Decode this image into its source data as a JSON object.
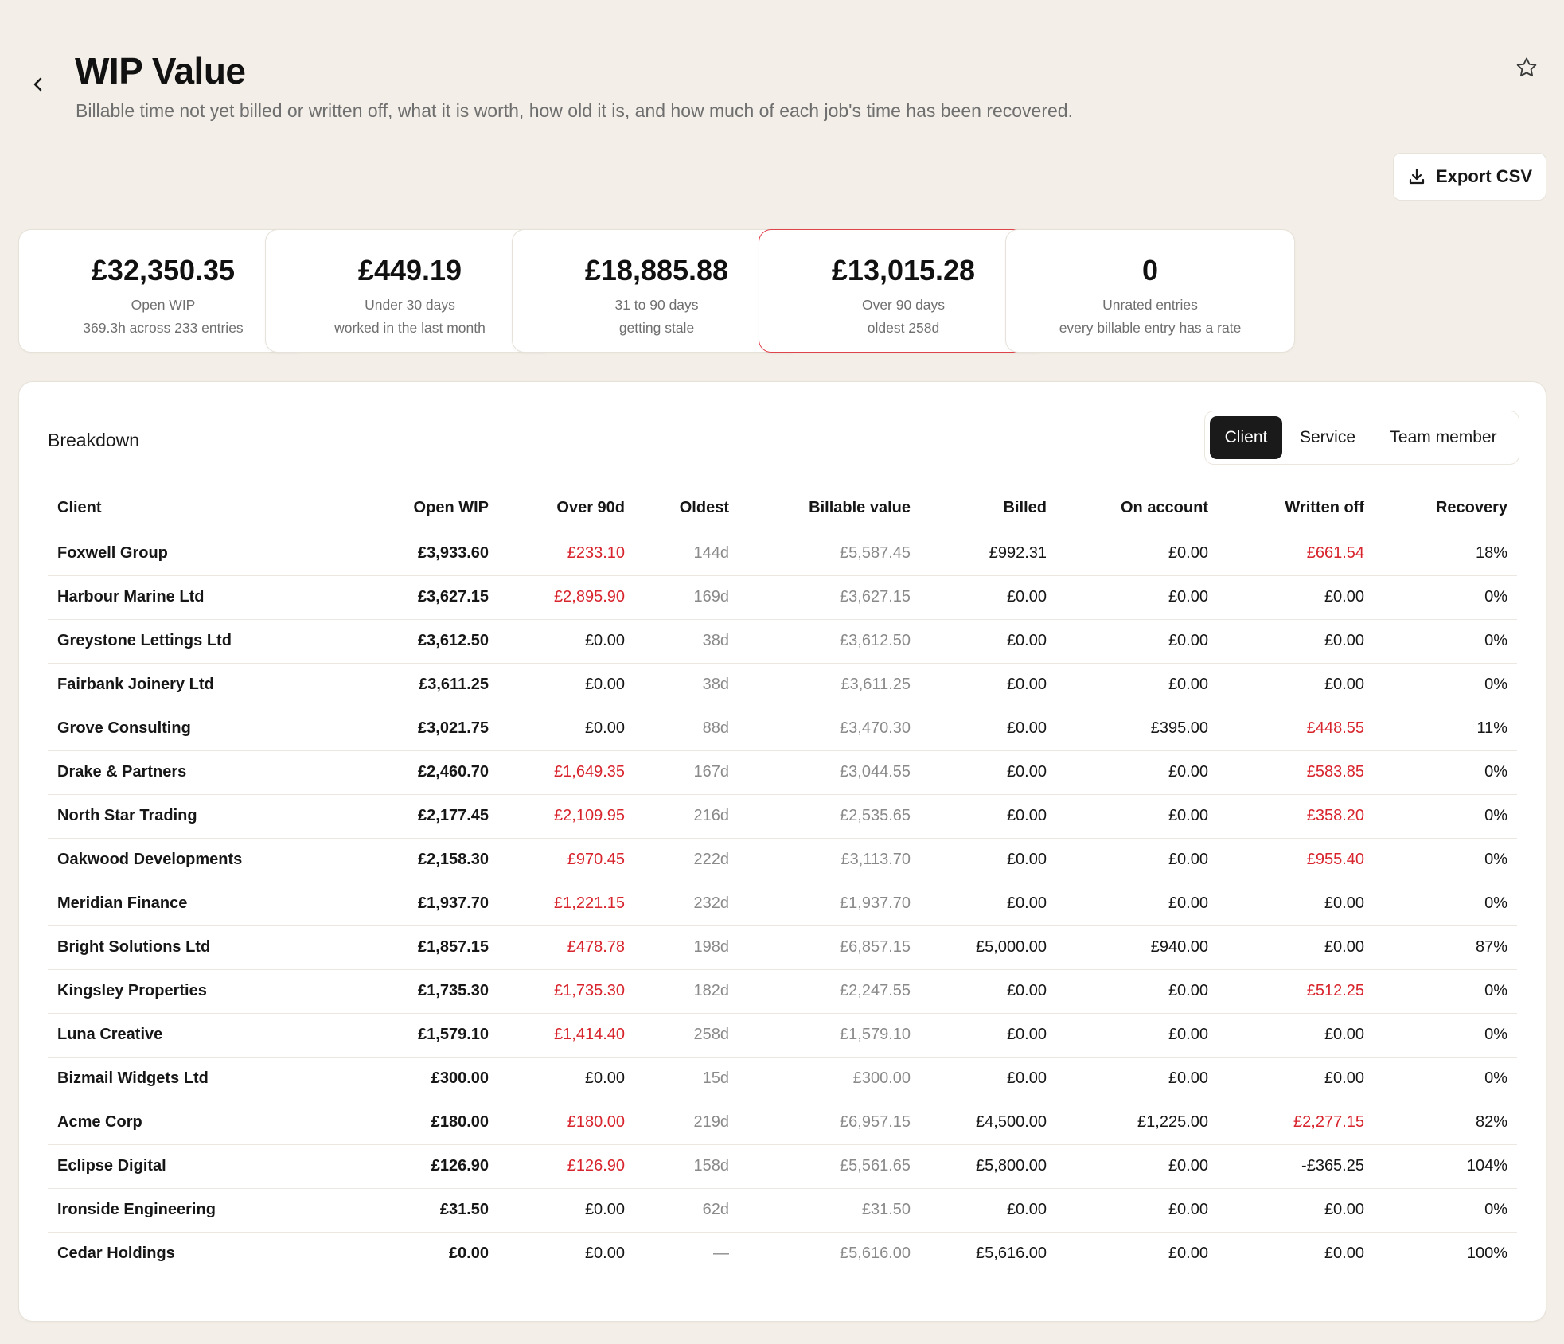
{
  "header": {
    "title": "WIP Value",
    "subtitle": "Billable time not yet billed or written off, what it is worth, how old it is, and how much of each job's time has been recovered.",
    "export_label": "Export CSV"
  },
  "cards": [
    {
      "value": "£32,350.35",
      "label": "Open WIP",
      "sub": "369.3h across 233 entries",
      "alert": false
    },
    {
      "value": "£449.19",
      "label": "Under 30 days",
      "sub": "worked in the last month",
      "alert": false
    },
    {
      "value": "£18,885.88",
      "label": "31 to 90 days",
      "sub": "getting stale",
      "alert": false
    },
    {
      "value": "£13,015.28",
      "label": "Over 90 days",
      "sub": "oldest 258d",
      "alert": true
    },
    {
      "value": "0",
      "label": "Unrated entries",
      "sub": "every billable entry has a rate",
      "alert": false
    }
  ],
  "breakdown": {
    "title": "Breakdown",
    "tabs": [
      "Client",
      "Service",
      "Team member"
    ],
    "active_tab": "Client",
    "columns": [
      "Client",
      "Open WIP",
      "Over 90d",
      "Oldest",
      "Billable value",
      "Billed",
      "On account",
      "Written off",
      "Recovery"
    ],
    "rows": [
      {
        "client": "Foxwell Group",
        "open_wip": "£3,933.60",
        "over_90d": "£233.10",
        "oldest": "144d",
        "billable": "£5,587.45",
        "billed": "£992.31",
        "on_account": "£0.00",
        "written_off": "£661.54",
        "recovery": "18%"
      },
      {
        "client": "Harbour Marine Ltd",
        "open_wip": "£3,627.15",
        "over_90d": "£2,895.90",
        "oldest": "169d",
        "billable": "£3,627.15",
        "billed": "£0.00",
        "on_account": "£0.00",
        "written_off": "£0.00",
        "recovery": "0%"
      },
      {
        "client": "Greystone Lettings Ltd",
        "open_wip": "£3,612.50",
        "over_90d": "£0.00",
        "oldest": "38d",
        "billable": "£3,612.50",
        "billed": "£0.00",
        "on_account": "£0.00",
        "written_off": "£0.00",
        "recovery": "0%"
      },
      {
        "client": "Fairbank Joinery Ltd",
        "open_wip": "£3,611.25",
        "over_90d": "£0.00",
        "oldest": "38d",
        "billable": "£3,611.25",
        "billed": "£0.00",
        "on_account": "£0.00",
        "written_off": "£0.00",
        "recovery": "0%"
      },
      {
        "client": "Grove Consulting",
        "open_wip": "£3,021.75",
        "over_90d": "£0.00",
        "oldest": "88d",
        "billable": "£3,470.30",
        "billed": "£0.00",
        "on_account": "£395.00",
        "written_off": "£448.55",
        "recovery": "11%"
      },
      {
        "client": "Drake & Partners",
        "open_wip": "£2,460.70",
        "over_90d": "£1,649.35",
        "oldest": "167d",
        "billable": "£3,044.55",
        "billed": "£0.00",
        "on_account": "£0.00",
        "written_off": "£583.85",
        "recovery": "0%"
      },
      {
        "client": "North Star Trading",
        "open_wip": "£2,177.45",
        "over_90d": "£2,109.95",
        "oldest": "216d",
        "billable": "£2,535.65",
        "billed": "£0.00",
        "on_account": "£0.00",
        "written_off": "£358.20",
        "recovery": "0%"
      },
      {
        "client": "Oakwood Developments",
        "open_wip": "£2,158.30",
        "over_90d": "£970.45",
        "oldest": "222d",
        "billable": "£3,113.70",
        "billed": "£0.00",
        "on_account": "£0.00",
        "written_off": "£955.40",
        "recovery": "0%"
      },
      {
        "client": "Meridian Finance",
        "open_wip": "£1,937.70",
        "over_90d": "£1,221.15",
        "oldest": "232d",
        "billable": "£1,937.70",
        "billed": "£0.00",
        "on_account": "£0.00",
        "written_off": "£0.00",
        "recovery": "0%"
      },
      {
        "client": "Bright Solutions Ltd",
        "open_wip": "£1,857.15",
        "over_90d": "£478.78",
        "oldest": "198d",
        "billable": "£6,857.15",
        "billed": "£5,000.00",
        "on_account": "£940.00",
        "written_off": "£0.00",
        "recovery": "87%"
      },
      {
        "client": "Kingsley Properties",
        "open_wip": "£1,735.30",
        "over_90d": "£1,735.30",
        "oldest": "182d",
        "billable": "£2,247.55",
        "billed": "£0.00",
        "on_account": "£0.00",
        "written_off": "£512.25",
        "recovery": "0%"
      },
      {
        "client": "Luna Creative",
        "open_wip": "£1,579.10",
        "over_90d": "£1,414.40",
        "oldest": "258d",
        "billable": "£1,579.10",
        "billed": "£0.00",
        "on_account": "£0.00",
        "written_off": "£0.00",
        "recovery": "0%"
      },
      {
        "client": "Bizmail Widgets Ltd",
        "open_wip": "£300.00",
        "over_90d": "£0.00",
        "oldest": "15d",
        "billable": "£300.00",
        "billed": "£0.00",
        "on_account": "£0.00",
        "written_off": "£0.00",
        "recovery": "0%"
      },
      {
        "client": "Acme Corp",
        "open_wip": "£180.00",
        "over_90d": "£180.00",
        "oldest": "219d",
        "billable": "£6,957.15",
        "billed": "£4,500.00",
        "on_account": "£1,225.00",
        "written_off": "£2,277.15",
        "recovery": "82%"
      },
      {
        "client": "Eclipse Digital",
        "open_wip": "£126.90",
        "over_90d": "£126.90",
        "oldest": "158d",
        "billable": "£5,561.65",
        "billed": "£5,800.00",
        "on_account": "£0.00",
        "written_off": "-£365.25",
        "recovery": "104%"
      },
      {
        "client": "Ironside Engineering",
        "open_wip": "£31.50",
        "over_90d": "£0.00",
        "oldest": "62d",
        "billable": "£31.50",
        "billed": "£0.00",
        "on_account": "£0.00",
        "written_off": "£0.00",
        "recovery": "0%"
      },
      {
        "client": "Cedar Holdings",
        "open_wip": "£0.00",
        "over_90d": "£0.00",
        "oldest": "—",
        "billable": "£5,616.00",
        "billed": "£5,616.00",
        "on_account": "£0.00",
        "written_off": "£0.00",
        "recovery": "100%"
      }
    ]
  },
  "icons": {
    "back": "chevron-left-icon",
    "favorite": "star-icon",
    "export": "download-icon"
  },
  "colors": {
    "background": "#f3efe8",
    "alert_red": "#d8242d",
    "active_tab": "#1a1a1a"
  }
}
